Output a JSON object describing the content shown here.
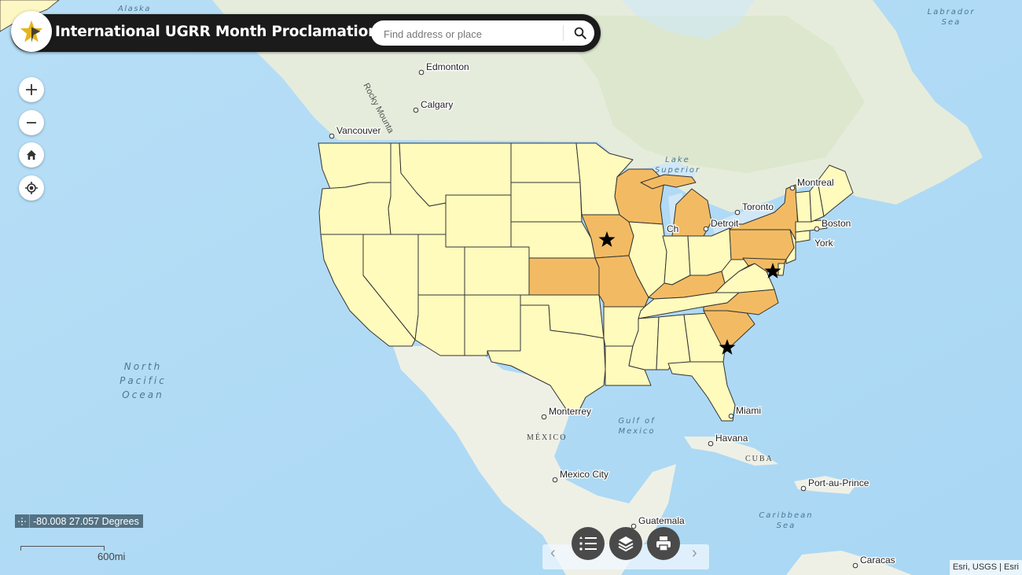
{
  "app": {
    "title": "International UGRR Month Proclamations",
    "logo_icon": "star-icon"
  },
  "search": {
    "placeholder": "Find address or place",
    "value": "",
    "button_icon": "search-icon"
  },
  "map_controls": [
    {
      "name": "zoom-in-button",
      "icon": "plus-icon",
      "glyph": "+"
    },
    {
      "name": "zoom-out-button",
      "icon": "minus-icon",
      "glyph": "−"
    },
    {
      "name": "home-button",
      "icon": "home-icon",
      "glyph": "⌂"
    },
    {
      "name": "locate-button",
      "icon": "locate-icon",
      "glyph": "◎"
    }
  ],
  "coordinates": {
    "text": "-80.008 27.057 Degrees"
  },
  "scale": {
    "label": "600mi"
  },
  "bottom_toolbar": {
    "buttons": [
      {
        "name": "legend-button",
        "icon": "list-icon"
      },
      {
        "name": "layers-button",
        "icon": "layers-icon"
      },
      {
        "name": "print-button",
        "icon": "print-icon"
      }
    ],
    "prev_label": "‹",
    "next_label": "›"
  },
  "attribution": "Esri, USGS | Esri",
  "colors": {
    "proclaimed_state": "#f2bb63",
    "other_state": "#fffbbd",
    "water": "#b3dcf5",
    "land": "#eef2e8",
    "header_bg": "#1b1b1b",
    "control_dark": "#4a4a4a"
  },
  "map": {
    "highlighted_states": [
      "Wisconsin",
      "Michigan",
      "Iowa",
      "Kansas",
      "Missouri",
      "Kentucky",
      "New York",
      "Pennsylvania",
      "Maryland",
      "North Carolina",
      "South Carolina"
    ],
    "star_markers": [
      "Iowa",
      "Maryland",
      "South Carolina"
    ],
    "place_labels": [
      {
        "text": "Alaska",
        "type": "region"
      },
      {
        "text": "Edmonton",
        "type": "city"
      },
      {
        "text": "Calgary",
        "type": "city"
      },
      {
        "text": "Vancouver",
        "type": "city"
      },
      {
        "text": "Rocky Mountains",
        "type": "feature"
      },
      {
        "text": "Lake Superior",
        "type": "water"
      },
      {
        "text": "Montreal",
        "type": "city"
      },
      {
        "text": "Toronto",
        "type": "city"
      },
      {
        "text": "Detroit",
        "type": "city"
      },
      {
        "text": "Chicago",
        "type": "city"
      },
      {
        "text": "Boston",
        "type": "city"
      },
      {
        "text": "New York",
        "type": "city"
      },
      {
        "text": "Labrador Sea",
        "type": "water"
      },
      {
        "text": "North Pacific Ocean",
        "type": "water"
      },
      {
        "text": "Monterrey",
        "type": "city"
      },
      {
        "text": "MÉXICO",
        "type": "country"
      },
      {
        "text": "Gulf of Mexico",
        "type": "water"
      },
      {
        "text": "Miami",
        "type": "city"
      },
      {
        "text": "Havana",
        "type": "city"
      },
      {
        "text": "CUBA",
        "type": "country"
      },
      {
        "text": "Mexico City",
        "type": "city"
      },
      {
        "text": "Port-au-Prince",
        "type": "city"
      },
      {
        "text": "Caribbean Sea",
        "type": "water"
      },
      {
        "text": "Guatemala",
        "type": "city"
      },
      {
        "text": "Caracas",
        "type": "city"
      }
    ]
  }
}
